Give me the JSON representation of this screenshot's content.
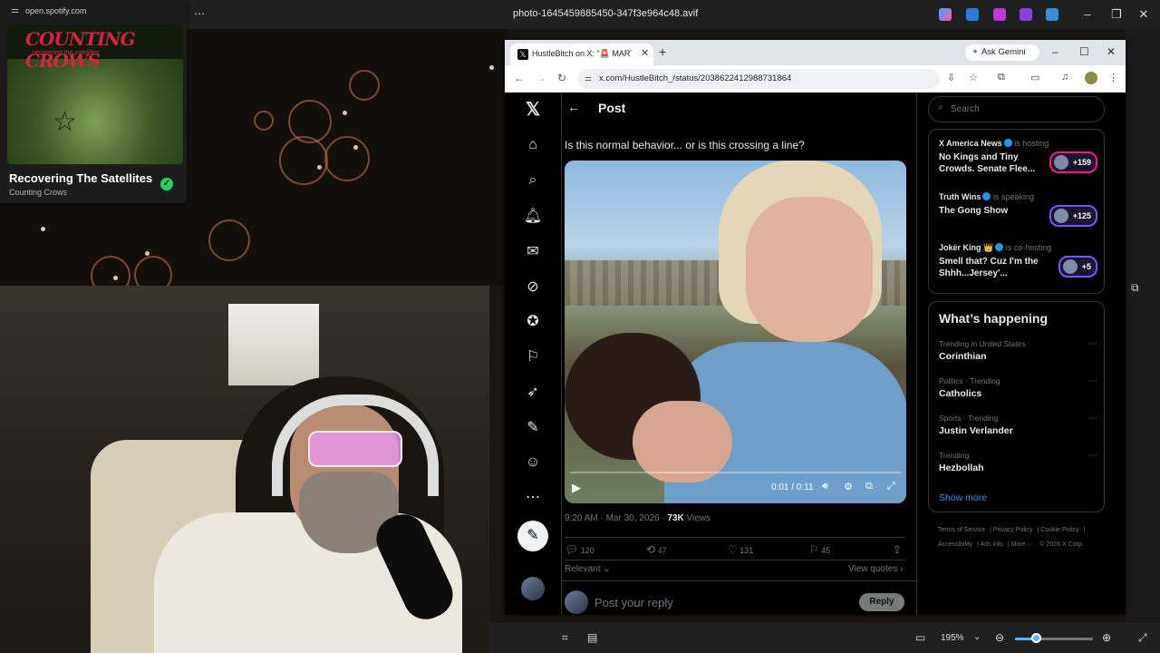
{
  "viewer": {
    "filename": "photo-1645459885450-347f3e964c48.avif",
    "zoom": "195%"
  },
  "spotify": {
    "url": "open.spotify.com",
    "album_art_title": "COUNTING CROWS",
    "album_art_subtitle": "recovering the satellites",
    "track_title": "Recovering The Satellites",
    "artist": "Counting Crows"
  },
  "browser": {
    "tab_title": "HustleBitch on X: \"🚨 MARTHA",
    "url": "x.com/HustleBitch_/status/2038622412988731864",
    "gemini_label": "Ask Gemini"
  },
  "post": {
    "heading": "Post",
    "text": "Is this normal behavior... or is this crossing a line?",
    "video_time": "0:01 / 0:11",
    "timestamp": "9:20 AM · Mar 30, 2026 · ",
    "views_count": "73K",
    "views_label": " Views",
    "replies": "120",
    "reposts": "47",
    "likes": "131",
    "bookmarks": "45",
    "relevant_label": "Relevant",
    "view_quotes_label": "View quotes",
    "reply_placeholder": "Post your reply",
    "reply_button": "Reply"
  },
  "sidebar": {
    "search_placeholder": "Search",
    "spaces": [
      {
        "host": "X America News",
        "status": "is hosting",
        "title": "No Kings and Tiny Crowds. Senate Flee...",
        "count": "+159"
      },
      {
        "host": "Truth Wins",
        "status": "is speaking",
        "title": "The Gong Show",
        "count": "+125"
      },
      {
        "host": "Jokër King 👑",
        "status": "is co-hosting",
        "title": "Smell that? Cuz I'm the Shhh...Jersey'...",
        "count": "+5"
      }
    ],
    "trends_heading": "What’s happening",
    "trends": [
      {
        "context": "Trending in United States",
        "name": "Corinthian"
      },
      {
        "context": "Politics · Trending",
        "name": "Catholics"
      },
      {
        "context": "Sports · Trending",
        "name": "Justin Verlander"
      },
      {
        "context": "Trending",
        "name": "Hezbollah"
      }
    ],
    "show_more": "Show more",
    "footer": [
      "Terms of Service",
      "Privacy Policy",
      "Cookie Policy",
      "Accessibility",
      "Ads info",
      "More ···",
      "© 2026 X Corp."
    ]
  },
  "colors": {
    "x_blue": "#1d9bf0",
    "spotify_green": "#1ed760",
    "space_purple": "#7856ff",
    "space_pink": "#f91880"
  }
}
